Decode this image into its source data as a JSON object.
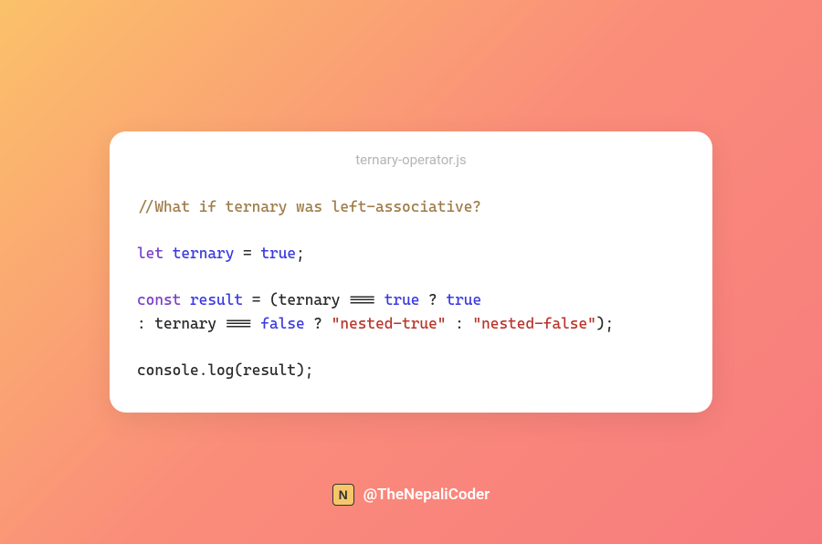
{
  "filename": "ternary-operator.js",
  "code_lines": [
    [
      {
        "cls": "tok-comment",
        "t": "//What if ternary was left-associative?"
      }
    ],
    [],
    [
      {
        "cls": "tok-keyword",
        "t": "let"
      },
      {
        "cls": "tok-default",
        "t": " "
      },
      {
        "cls": "tok-ident",
        "t": "ternary"
      },
      {
        "cls": "tok-default",
        "t": " "
      },
      {
        "cls": "tok-op",
        "t": "="
      },
      {
        "cls": "tok-default",
        "t": " "
      },
      {
        "cls": "tok-bool",
        "t": "true"
      },
      {
        "cls": "tok-punct",
        "t": ";"
      }
    ],
    [],
    [
      {
        "cls": "tok-keyword",
        "t": "const"
      },
      {
        "cls": "tok-default",
        "t": " "
      },
      {
        "cls": "tok-ident",
        "t": "result"
      },
      {
        "cls": "tok-default",
        "t": " "
      },
      {
        "cls": "tok-op",
        "t": "="
      },
      {
        "cls": "tok-default",
        "t": " "
      },
      {
        "cls": "tok-punct",
        "t": "("
      },
      {
        "cls": "tok-default",
        "t": "ternary "
      },
      {
        "cls": "tok-op",
        "t": "==="
      },
      {
        "cls": "tok-default",
        "t": " "
      },
      {
        "cls": "tok-bool",
        "t": "true"
      },
      {
        "cls": "tok-default",
        "t": " "
      },
      {
        "cls": "tok-op",
        "t": "?"
      },
      {
        "cls": "tok-default",
        "t": " "
      },
      {
        "cls": "tok-bool",
        "t": "true"
      }
    ],
    [
      {
        "cls": "tok-op",
        "t": ":"
      },
      {
        "cls": "tok-default",
        "t": " ternary "
      },
      {
        "cls": "tok-op",
        "t": "==="
      },
      {
        "cls": "tok-default",
        "t": " "
      },
      {
        "cls": "tok-bool",
        "t": "false"
      },
      {
        "cls": "tok-default",
        "t": " "
      },
      {
        "cls": "tok-op",
        "t": "?"
      },
      {
        "cls": "tok-default",
        "t": " "
      },
      {
        "cls": "tok-string",
        "t": "\"nested-true\""
      },
      {
        "cls": "tok-default",
        "t": " "
      },
      {
        "cls": "tok-op",
        "t": ":"
      },
      {
        "cls": "tok-default",
        "t": " "
      },
      {
        "cls": "tok-string",
        "t": "\"nested-false\""
      },
      {
        "cls": "tok-punct",
        "t": ")"
      },
      {
        "cls": "tok-punct",
        "t": ";"
      }
    ],
    [],
    [
      {
        "cls": "tok-default",
        "t": "console"
      },
      {
        "cls": "tok-punct",
        "t": "."
      },
      {
        "cls": "tok-default",
        "t": "log"
      },
      {
        "cls": "tok-punct",
        "t": "("
      },
      {
        "cls": "tok-default",
        "t": "result"
      },
      {
        "cls": "tok-punct",
        "t": ")"
      },
      {
        "cls": "tok-punct",
        "t": ";"
      }
    ]
  ],
  "footer": {
    "handle": "@TheNepaliCoder",
    "icon_letter": "N"
  }
}
